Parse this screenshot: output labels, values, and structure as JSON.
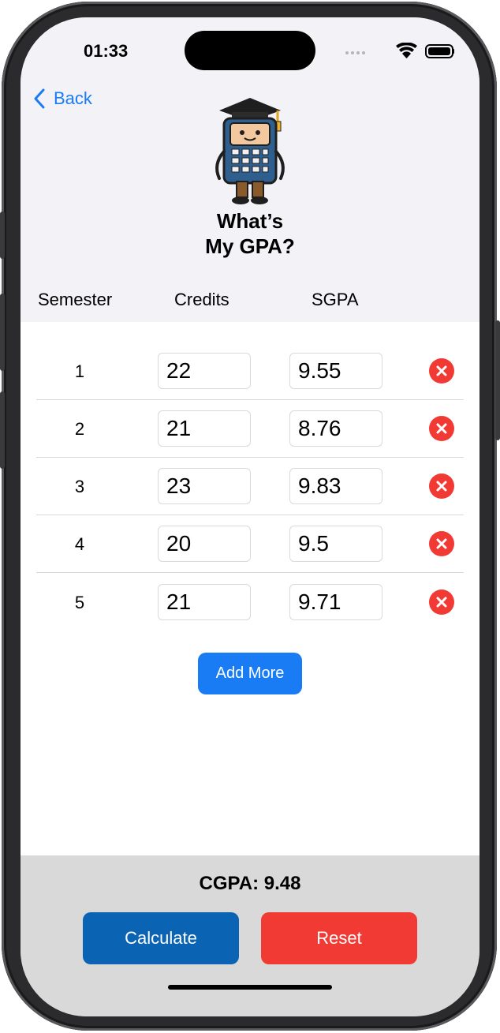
{
  "status_bar": {
    "time": "01:33"
  },
  "nav": {
    "back_label": "Back"
  },
  "app": {
    "title_line1": "What’s",
    "title_line2": "My GPA?"
  },
  "table": {
    "headers": [
      "Semester",
      "Credits",
      "SGPA"
    ],
    "rows": [
      {
        "semester": "1",
        "credits": "22",
        "sgpa": "9.55"
      },
      {
        "semester": "2",
        "credits": "21",
        "sgpa": "8.76"
      },
      {
        "semester": "3",
        "credits": "23",
        "sgpa": "9.83"
      },
      {
        "semester": "4",
        "credits": "20",
        "sgpa": "9.5"
      },
      {
        "semester": "5",
        "credits": "21",
        "sgpa": "9.71"
      }
    ]
  },
  "actions": {
    "add_more": "Add More",
    "calculate": "Calculate",
    "reset": "Reset"
  },
  "result": {
    "cgpa_text": "CGPA: 9.48"
  },
  "icons": {
    "back": "chevron-left-icon",
    "delete": "xmark-circle-icon",
    "wifi": "wifi-icon",
    "battery": "battery-icon",
    "signal": "cellular-signal-icon",
    "mascot": "calculator-mascot-icon"
  },
  "colors": {
    "accent": "#1a7cf5",
    "danger": "#f23a34",
    "calculate": "#0a64b3",
    "header_bg": "#f2f2f7",
    "footer_bg": "#d9d9d9"
  }
}
